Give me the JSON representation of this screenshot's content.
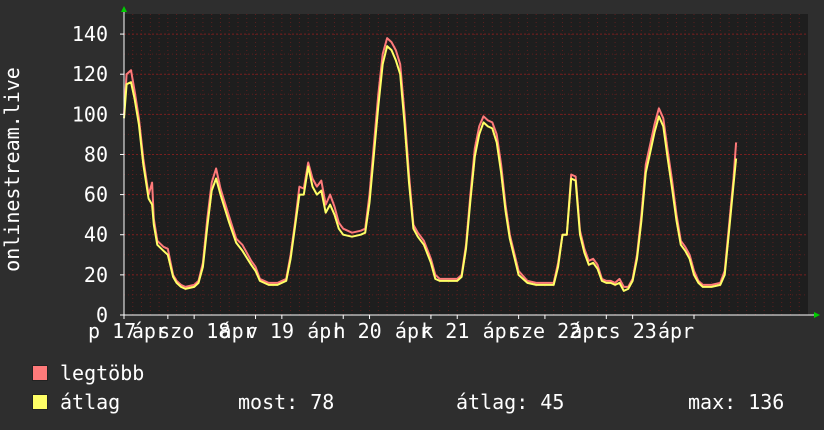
{
  "colors": {
    "background": "#2e2e2e",
    "plot_background": "#1e1e1e",
    "grid": "#7a1f1f",
    "max_series": "#ff7a7a",
    "avg_series": "#ffff66",
    "axis_arrow": "#00cc00",
    "text": "#ffffff"
  },
  "legend": {
    "max_label": "legtöbb",
    "avg_label": "átlag",
    "now_text": "most: 78",
    "avg_text": "átlag: 45",
    "max_text": "max: 136"
  },
  "chart_data": {
    "type": "line",
    "title": "",
    "ylabel": "onlinestream.live",
    "xlabel": "",
    "ylim": [
      0,
      150
    ],
    "y_ticks": [
      0,
      20,
      40,
      60,
      80,
      100,
      120,
      140
    ],
    "x_range": [
      0,
      7.8
    ],
    "x_ticks": [
      {
        "x": 0.0,
        "label": "p 17"
      },
      {
        "x": 0.5,
        "label": "ápr"
      },
      {
        "x": 0.8,
        "label": "szo 18"
      },
      {
        "x": 1.5,
        "label": "ápr"
      },
      {
        "x": 1.8,
        "label": "v 19"
      },
      {
        "x": 2.5,
        "label": "ápr"
      },
      {
        "x": 2.8,
        "label": "h 20"
      },
      {
        "x": 3.5,
        "label": "ápr"
      },
      {
        "x": 3.8,
        "label": "k 21"
      },
      {
        "x": 4.5,
        "label": "ápr"
      },
      {
        "x": 4.8,
        "label": "sze 22"
      },
      {
        "x": 5.5,
        "label": "ápr"
      },
      {
        "x": 5.8,
        "label": "cs 23"
      },
      {
        "x": 6.5,
        "label": "ápr"
      }
    ],
    "legend_position": "bottom-left",
    "grid": true,
    "series": [
      {
        "name": "legtöbb",
        "color": "#ff7a7a",
        "points": [
          [
            0.0,
            100
          ],
          [
            0.03,
            120
          ],
          [
            0.08,
            122
          ],
          [
            0.12,
            112
          ],
          [
            0.17,
            98
          ],
          [
            0.22,
            78
          ],
          [
            0.28,
            60
          ],
          [
            0.32,
            66
          ],
          [
            0.34,
            48
          ],
          [
            0.38,
            37
          ],
          [
            0.45,
            34
          ],
          [
            0.5,
            33
          ],
          [
            0.56,
            20
          ],
          [
            0.6,
            17
          ],
          [
            0.65,
            15
          ],
          [
            0.7,
            14
          ],
          [
            0.8,
            15
          ],
          [
            0.85,
            17
          ],
          [
            0.9,
            26
          ],
          [
            0.95,
            48
          ],
          [
            1.0,
            66
          ],
          [
            1.05,
            73
          ],
          [
            1.1,
            63
          ],
          [
            1.15,
            56
          ],
          [
            1.2,
            49
          ],
          [
            1.28,
            38
          ],
          [
            1.35,
            35
          ],
          [
            1.45,
            27
          ],
          [
            1.5,
            24
          ],
          [
            1.55,
            18
          ],
          [
            1.65,
            16
          ],
          [
            1.75,
            16
          ],
          [
            1.85,
            18
          ],
          [
            1.9,
            30
          ],
          [
            1.95,
            46
          ],
          [
            2.0,
            64
          ],
          [
            2.05,
            63
          ],
          [
            2.1,
            76
          ],
          [
            2.15,
            68
          ],
          [
            2.2,
            64
          ],
          [
            2.25,
            67
          ],
          [
            2.3,
            55
          ],
          [
            2.35,
            60
          ],
          [
            2.4,
            54
          ],
          [
            2.45,
            46
          ],
          [
            2.5,
            43
          ],
          [
            2.6,
            41
          ],
          [
            2.7,
            42
          ],
          [
            2.75,
            43
          ],
          [
            2.8,
            60
          ],
          [
            2.85,
            85
          ],
          [
            2.9,
            110
          ],
          [
            2.95,
            130
          ],
          [
            3.0,
            138
          ],
          [
            3.05,
            136
          ],
          [
            3.1,
            132
          ],
          [
            3.15,
            125
          ],
          [
            3.2,
            100
          ],
          [
            3.25,
            70
          ],
          [
            3.3,
            45
          ],
          [
            3.35,
            41
          ],
          [
            3.42,
            37
          ],
          [
            3.5,
            28
          ],
          [
            3.55,
            20
          ],
          [
            3.6,
            18
          ],
          [
            3.7,
            18
          ],
          [
            3.8,
            18
          ],
          [
            3.85,
            20
          ],
          [
            3.9,
            35
          ],
          [
            3.95,
            60
          ],
          [
            4.0,
            83
          ],
          [
            4.05,
            94
          ],
          [
            4.1,
            99
          ],
          [
            4.15,
            97
          ],
          [
            4.2,
            96
          ],
          [
            4.25,
            90
          ],
          [
            4.3,
            75
          ],
          [
            4.35,
            55
          ],
          [
            4.4,
            40
          ],
          [
            4.45,
            31
          ],
          [
            4.5,
            22
          ],
          [
            4.6,
            17
          ],
          [
            4.7,
            16
          ],
          [
            4.8,
            16
          ],
          [
            4.9,
            16
          ],
          [
            4.95,
            26
          ],
          [
            5.0,
            40
          ],
          [
            5.05,
            40
          ],
          [
            5.1,
            70
          ],
          [
            5.15,
            69
          ],
          [
            5.2,
            42
          ],
          [
            5.25,
            33
          ],
          [
            5.3,
            27
          ],
          [
            5.35,
            28
          ],
          [
            5.4,
            25
          ],
          [
            5.45,
            18
          ],
          [
            5.5,
            17
          ],
          [
            5.55,
            17
          ],
          [
            5.6,
            16
          ],
          [
            5.65,
            18
          ],
          [
            5.7,
            14
          ],
          [
            5.75,
            14
          ],
          [
            5.8,
            18
          ],
          [
            5.85,
            30
          ],
          [
            5.9,
            50
          ],
          [
            5.95,
            75
          ],
          [
            6.0,
            85
          ],
          [
            6.05,
            95
          ],
          [
            6.1,
            103
          ],
          [
            6.15,
            98
          ],
          [
            6.2,
            82
          ],
          [
            6.25,
            67
          ],
          [
            6.3,
            50
          ],
          [
            6.35,
            37
          ],
          [
            6.4,
            34
          ],
          [
            6.45,
            30
          ],
          [
            6.5,
            22
          ],
          [
            6.55,
            17
          ],
          [
            6.6,
            15
          ],
          [
            6.7,
            15
          ],
          [
            6.8,
            16
          ],
          [
            6.85,
            22
          ],
          [
            6.9,
            45
          ],
          [
            6.95,
            68
          ],
          [
            6.98,
            86
          ]
        ]
      },
      {
        "name": "átlag",
        "color": "#ffff66",
        "points": [
          [
            0.0,
            98
          ],
          [
            0.03,
            115
          ],
          [
            0.08,
            116
          ],
          [
            0.12,
            108
          ],
          [
            0.17,
            95
          ],
          [
            0.22,
            75
          ],
          [
            0.28,
            58
          ],
          [
            0.32,
            55
          ],
          [
            0.34,
            45
          ],
          [
            0.38,
            35
          ],
          [
            0.45,
            32
          ],
          [
            0.5,
            30
          ],
          [
            0.56,
            19
          ],
          [
            0.6,
            16
          ],
          [
            0.65,
            14
          ],
          [
            0.7,
            13
          ],
          [
            0.8,
            14
          ],
          [
            0.85,
            16
          ],
          [
            0.9,
            24
          ],
          [
            0.95,
            44
          ],
          [
            1.0,
            62
          ],
          [
            1.05,
            68
          ],
          [
            1.1,
            60
          ],
          [
            1.15,
            53
          ],
          [
            1.2,
            46
          ],
          [
            1.28,
            36
          ],
          [
            1.35,
            32
          ],
          [
            1.45,
            25
          ],
          [
            1.5,
            22
          ],
          [
            1.55,
            17
          ],
          [
            1.65,
            15
          ],
          [
            1.75,
            15
          ],
          [
            1.85,
            17
          ],
          [
            1.9,
            28
          ],
          [
            1.95,
            44
          ],
          [
            2.0,
            60
          ],
          [
            2.05,
            60
          ],
          [
            2.1,
            74
          ],
          [
            2.15,
            64
          ],
          [
            2.2,
            60
          ],
          [
            2.25,
            62
          ],
          [
            2.3,
            51
          ],
          [
            2.35,
            55
          ],
          [
            2.4,
            50
          ],
          [
            2.45,
            43
          ],
          [
            2.5,
            40
          ],
          [
            2.6,
            39
          ],
          [
            2.7,
            40
          ],
          [
            2.75,
            41
          ],
          [
            2.8,
            56
          ],
          [
            2.85,
            80
          ],
          [
            2.9,
            104
          ],
          [
            2.95,
            125
          ],
          [
            3.0,
            134
          ],
          [
            3.05,
            132
          ],
          [
            3.1,
            127
          ],
          [
            3.15,
            120
          ],
          [
            3.2,
            95
          ],
          [
            3.25,
            66
          ],
          [
            3.3,
            43
          ],
          [
            3.35,
            39
          ],
          [
            3.42,
            35
          ],
          [
            3.5,
            26
          ],
          [
            3.55,
            18
          ],
          [
            3.6,
            17
          ],
          [
            3.7,
            17
          ],
          [
            3.8,
            17
          ],
          [
            3.85,
            19
          ],
          [
            3.9,
            33
          ],
          [
            3.95,
            57
          ],
          [
            4.0,
            79
          ],
          [
            4.05,
            90
          ],
          [
            4.1,
            96
          ],
          [
            4.15,
            94
          ],
          [
            4.2,
            93
          ],
          [
            4.25,
            86
          ],
          [
            4.3,
            71
          ],
          [
            4.35,
            52
          ],
          [
            4.4,
            38
          ],
          [
            4.45,
            29
          ],
          [
            4.5,
            20
          ],
          [
            4.6,
            16
          ],
          [
            4.7,
            15
          ],
          [
            4.8,
            15
          ],
          [
            4.9,
            15
          ],
          [
            4.95,
            24
          ],
          [
            5.0,
            40
          ],
          [
            5.05,
            40
          ],
          [
            5.1,
            68
          ],
          [
            5.15,
            67
          ],
          [
            5.2,
            40
          ],
          [
            5.25,
            31
          ],
          [
            5.3,
            25
          ],
          [
            5.35,
            26
          ],
          [
            5.4,
            23
          ],
          [
            5.45,
            17
          ],
          [
            5.5,
            16
          ],
          [
            5.55,
            16
          ],
          [
            5.6,
            15
          ],
          [
            5.65,
            16
          ],
          [
            5.7,
            12
          ],
          [
            5.75,
            13
          ],
          [
            5.8,
            17
          ],
          [
            5.85,
            28
          ],
          [
            5.9,
            47
          ],
          [
            5.95,
            71
          ],
          [
            6.0,
            81
          ],
          [
            6.05,
            91
          ],
          [
            6.1,
            99
          ],
          [
            6.15,
            94
          ],
          [
            6.2,
            78
          ],
          [
            6.25,
            63
          ],
          [
            6.3,
            47
          ],
          [
            6.35,
            35
          ],
          [
            6.4,
            32
          ],
          [
            6.45,
            28
          ],
          [
            6.5,
            20
          ],
          [
            6.55,
            16
          ],
          [
            6.6,
            14
          ],
          [
            6.7,
            14
          ],
          [
            6.8,
            15
          ],
          [
            6.85,
            20
          ],
          [
            6.9,
            42
          ],
          [
            6.95,
            65
          ],
          [
            6.98,
            78
          ]
        ]
      }
    ]
  }
}
